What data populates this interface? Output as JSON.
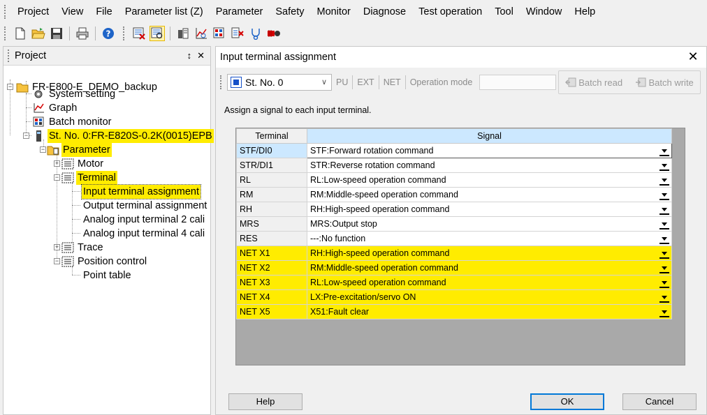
{
  "menubar": {
    "items": [
      "Project",
      "View",
      "File",
      "Parameter list (Z)",
      "Parameter",
      "Safety",
      "Monitor",
      "Diagnose",
      "Test operation",
      "Tool",
      "Window",
      "Help"
    ]
  },
  "toolbar": {
    "icons": [
      "new-file-icon",
      "open-folder-icon",
      "save-icon",
      "print-icon",
      "help-icon",
      "parameter-check-icon",
      "parameter-verify-icon",
      "system-setting-icon",
      "graph-icon",
      "batch-monitor-icon",
      "diagnose-icon",
      "oscilloscope-icon",
      "test-operation-icon"
    ]
  },
  "project": {
    "title": "Project",
    "pin": "↕",
    "close": "✕",
    "tree": {
      "root": "FR-E800-E_DEMO_backup",
      "system_setting": "System setting",
      "graph": "Graph",
      "batch_monitor": "Batch monitor",
      "station": "St. No. 0:FR-E820S-0.2K(0015)EPB",
      "parameter": "Parameter",
      "motor": "Motor",
      "terminal": "Terminal",
      "input_terminal": "Input terminal assignment",
      "output_terminal": "Output terminal assignment",
      "analog2": "Analog input terminal 2 cali",
      "analog4": "Analog input terminal 4 cali",
      "trace": "Trace",
      "position_control": "Position control",
      "point_table": "Point table"
    }
  },
  "dialog": {
    "title": "Input terminal assignment",
    "close": "✕",
    "station_select": "St. No. 0",
    "mode_buttons": [
      "PU",
      "EXT",
      "NET",
      "Operation mode"
    ],
    "operation_mode_value": "",
    "batch_read": "Batch read",
    "batch_write": "Batch write",
    "instruction": "Assign a signal to each input terminal.",
    "table": {
      "headers": {
        "terminal": "Terminal",
        "signal": "Signal"
      },
      "rows": [
        {
          "terminal": "STF/DI0",
          "signal": "STF:Forward rotation command"
        },
        {
          "terminal": "STR/DI1",
          "signal": "STR:Reverse rotation command"
        },
        {
          "terminal": "RL",
          "signal": "RL:Low-speed operation command"
        },
        {
          "terminal": "RM",
          "signal": "RM:Middle-speed operation command"
        },
        {
          "terminal": "RH",
          "signal": "RH:High-speed operation command"
        },
        {
          "terminal": "MRS",
          "signal": "MRS:Output stop"
        },
        {
          "terminal": "RES",
          "signal": "---:No function"
        },
        {
          "terminal": "NET X1",
          "signal": "RH:High-speed operation command"
        },
        {
          "terminal": "NET X2",
          "signal": "RM:Middle-speed operation command"
        },
        {
          "terminal": "NET X3",
          "signal": "RL:Low-speed operation command"
        },
        {
          "terminal": "NET X4",
          "signal": "LX:Pre-excitation/servo ON"
        },
        {
          "terminal": "NET X5",
          "signal": "X51:Fault clear"
        }
      ]
    },
    "buttons": {
      "help": "Help",
      "ok": "OK",
      "cancel": "Cancel"
    }
  },
  "colors": {
    "highlight": "#ffec00",
    "selection": "#cce8ff",
    "accent": "#0078d7"
  }
}
